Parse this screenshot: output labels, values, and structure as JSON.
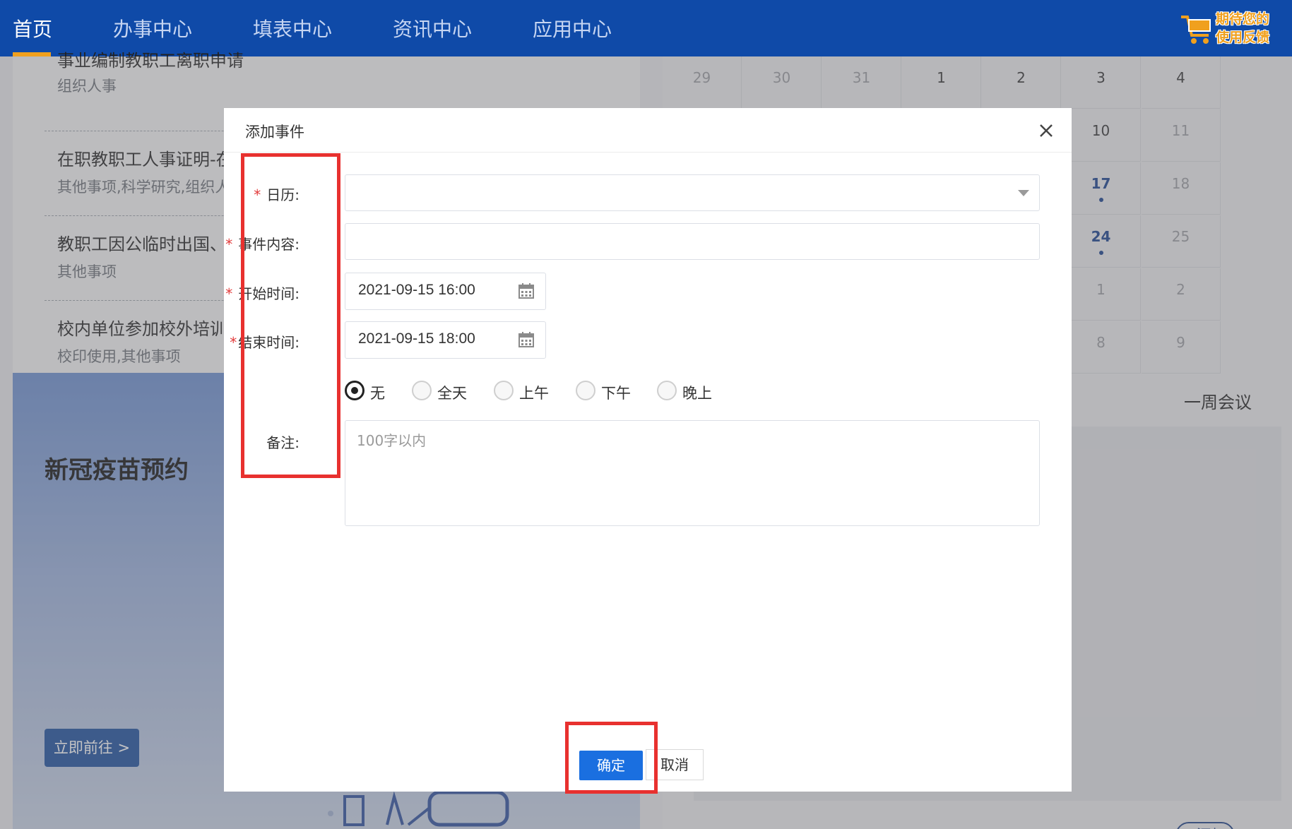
{
  "nav": {
    "items": [
      "首页",
      "办事中心",
      "填表中心",
      "资讯中心",
      "应用中心"
    ],
    "active_index": 0,
    "feedback_line1": "期待您的",
    "feedback_line2": "使用反馈"
  },
  "list": [
    {
      "title": "事业编制教职工离职申请",
      "tags": "组织人事"
    },
    {
      "title": "在职教职工人事证明-在职",
      "tags": "其他事项,科学研究,组织人事"
    },
    {
      "title": "教职工因公临时出国、赴",
      "tags": "其他事项"
    },
    {
      "title": "校内单位参加校外培训项",
      "tags": "校印使用,其他事项"
    }
  ],
  "banner": {
    "title": "新冠疫苗预约",
    "button": "立即前往 >"
  },
  "calendar": {
    "rows": [
      [
        "29",
        "30",
        "31",
        "1",
        "2",
        "3",
        "4"
      ],
      [
        "",
        "",
        "",
        "",
        "",
        "10",
        "11"
      ],
      [
        "",
        "",
        "",
        "",
        "",
        "17",
        "18"
      ],
      [
        "",
        "",
        "",
        "",
        "",
        "24",
        "25"
      ],
      [
        "",
        "",
        "",
        "",
        "",
        "1",
        "2"
      ],
      [
        "",
        "",
        "",
        "",
        "",
        "8",
        "9"
      ]
    ],
    "event_days": [
      "17",
      "24"
    ]
  },
  "week_meeting": {
    "title": "一周会议",
    "add_label": "+添加"
  },
  "modal": {
    "title": "添加事件",
    "fields": {
      "calendar_label": "日历:",
      "content_label": "事件内容:",
      "start_label": "开始时间:",
      "end_label": "结束时间:",
      "remark_label": "备注:",
      "start_value": "2021-09-15 16:00",
      "end_value": "2021-09-15 18:00",
      "remark_placeholder": "100字以内"
    },
    "time_options": [
      "无",
      "全天",
      "上午",
      "下午",
      "晚上"
    ],
    "selected_time_option": "无",
    "ok_label": "确定",
    "cancel_label": "取消"
  },
  "colors": {
    "nav_bg": "#0f4aa8",
    "primary": "#1a6fe0",
    "required": "#e23a3a",
    "highlight": "#e8312f"
  }
}
